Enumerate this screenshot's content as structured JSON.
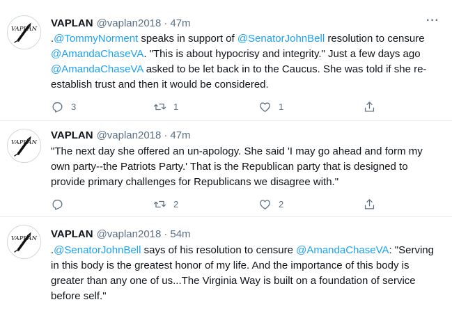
{
  "tweets": [
    {
      "name": "VAPLAN",
      "handle": "@vaplan2018",
      "separator": "·",
      "time": "47m",
      "avatar_text": "VAPLAN",
      "text_parts": [
        ".",
        "@TommyNorment",
        " speaks in support of ",
        "@SenatorJohnBell",
        " resolution to censure ",
        "@AmandaChaseVA",
        ". \"This is about hypocrisy and integrity.\" Just a few days ago ",
        "@AmandaChaseVA",
        " asked to be let back in to the Caucus. She was told if she re-establish trust and then it would be considered."
      ],
      "replies": "3",
      "retweets": "1",
      "likes": "1"
    },
    {
      "name": "VAPLAN",
      "handle": "@vaplan2018",
      "separator": "·",
      "time": "47m",
      "avatar_text": "VAPLAN",
      "text": "\"The next day she offered an un-apology. She said 'I may go ahead and form my own party--the Patriots Party.' That is the Republican party that is designed to provide primary challenges for Republicans we disagree with.\"",
      "replies": "",
      "retweets": "2",
      "likes": "2"
    },
    {
      "name": "VAPLAN",
      "handle": "@vaplan2018",
      "separator": "·",
      "time": "54m",
      "avatar_text": "VAPLAN",
      "text_parts": [
        ".",
        "@SenatorJohnBell",
        " says of his resolution to censure ",
        "@AmandaChaseVA",
        ": \"Serving in this body is the greatest honor of my life. And the importance of this body is greater than any one of us...The Virginia Way is built on a foundation of service before self.\""
      ]
    }
  ],
  "colors": {
    "mention": "#1da1f2",
    "secondary_text": "#5b7083",
    "divider": "#e6ecf0"
  },
  "icons": {
    "more": "more-options-icon",
    "reply": "reply-icon",
    "retweet": "retweet-icon",
    "like": "like-icon",
    "share": "share-icon"
  }
}
